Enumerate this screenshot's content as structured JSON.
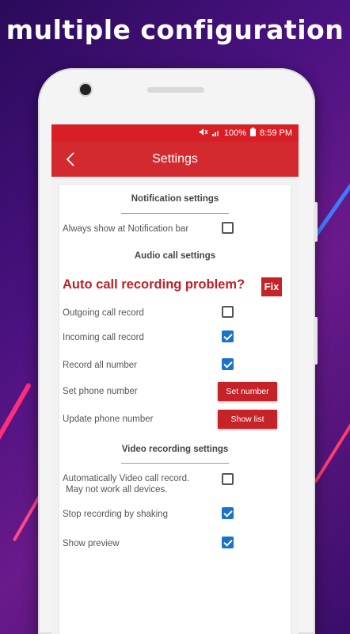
{
  "headline": "multiple configuration",
  "status_bar": {
    "battery": "100%",
    "time": "8:59 PM"
  },
  "app_bar": {
    "title": "Settings"
  },
  "notification": {
    "title": "Notification settings",
    "always_show": {
      "label": "Always show at Notification bar",
      "checked": false
    }
  },
  "audio": {
    "title": "Audio call settings",
    "problem_text": "Auto call recording problem?",
    "fix_label": "Fix",
    "outgoing": {
      "label": "Outgoing call record",
      "checked": false
    },
    "incoming": {
      "label": "Incoming call record",
      "checked": true
    },
    "record_all": {
      "label": "Record all number",
      "checked": true
    },
    "set_phone": {
      "label": "Set phone number",
      "button": "Set number"
    },
    "update_phone": {
      "label": "Update phone number",
      "button": "Show list"
    }
  },
  "video": {
    "title": "Video recording settings",
    "auto_video": {
      "label_line1": "Automatically Video call record.",
      "label_line2": "May not work all devices.",
      "checked": false
    },
    "stop_shaking": {
      "label": "Stop recording by shaking",
      "checked": true
    },
    "show_preview": {
      "label": "Show preview",
      "checked": true
    }
  },
  "colors": {
    "primary": "#d32a2f",
    "status": "#d81f26",
    "checkbox": "#1a73c9"
  }
}
